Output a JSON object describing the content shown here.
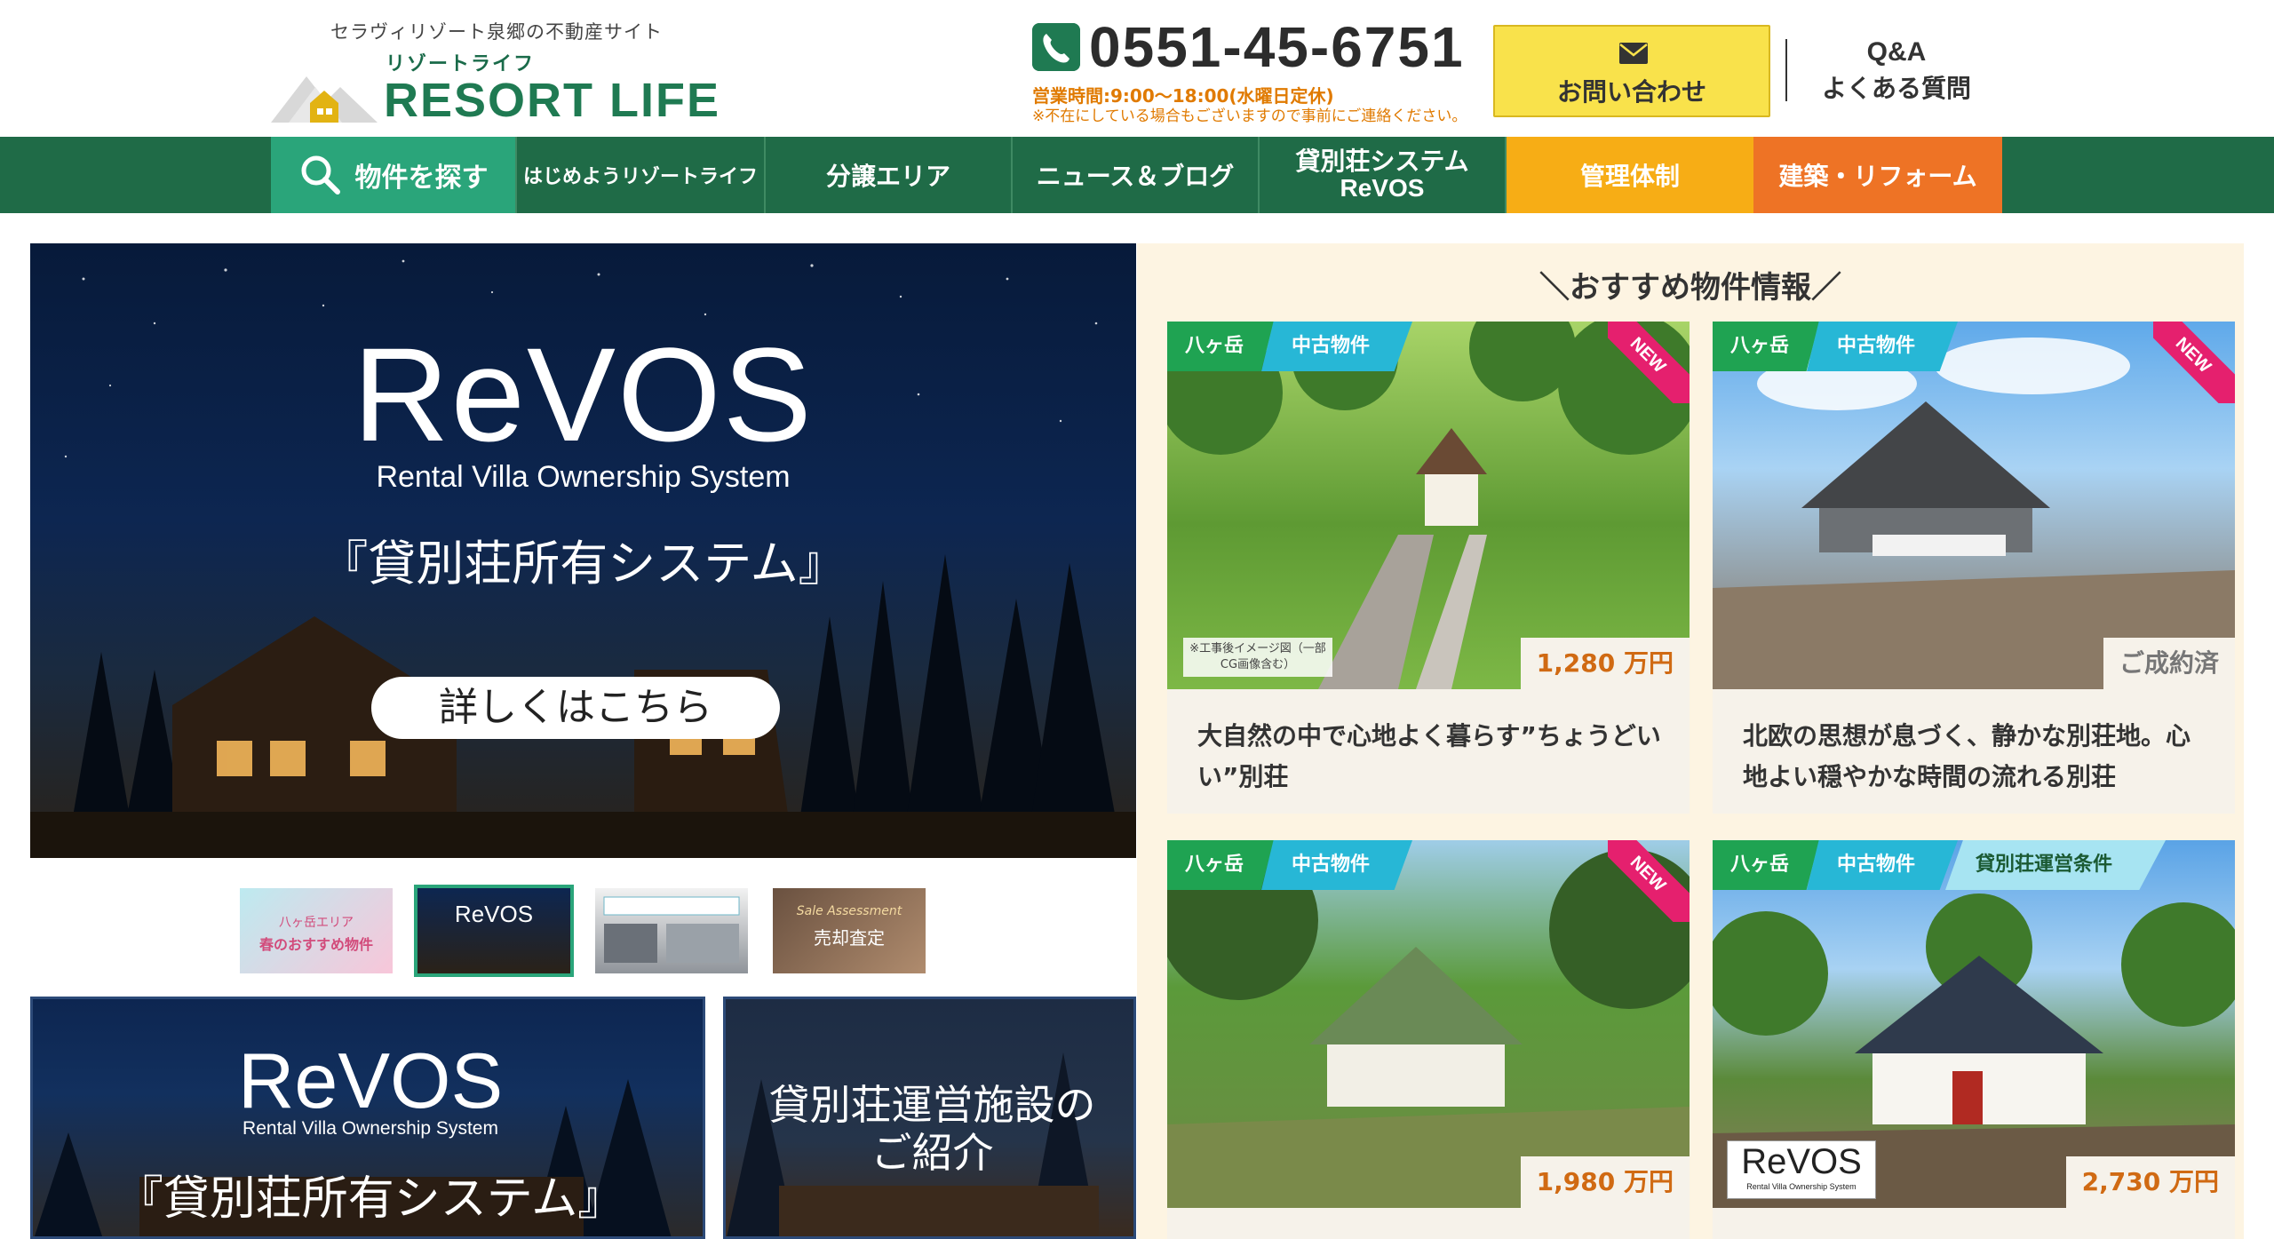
{
  "header": {
    "tagline": "セラヴィリゾート泉郷の不動産サイト",
    "logo_sub": "リゾートライフ",
    "logo_main": "RESORT LIFE",
    "phone": "0551-45-6751",
    "hours": "営業時間:9:00～18:00(水曜日定休)",
    "hours_note": "※不在にしている場合もございますので事前にご連絡ください。",
    "contact_label": "お問い合わせ",
    "faq_line1": "Q&A",
    "faq_line2": "よくある質問"
  },
  "nav": {
    "search": "物件を探す",
    "start": "はじめようリゾートライフ",
    "area": "分譲エリア",
    "news": "ニュース＆ブログ",
    "rental_line1": "貸別荘システム",
    "rental_line2": "ReVOS",
    "mgmt": "管理体制",
    "build": "建築・リフォーム"
  },
  "hero": {
    "title": "ReVOS",
    "subtitle": "Rental Villa Ownership System",
    "jp": "『貸別荘所有システム』",
    "button": "詳しくはこちら"
  },
  "thumbs": {
    "t1_line1": "八ヶ岳エリア",
    "t1_line2": "春のおすすめ物件",
    "t2": "ReVOS",
    "t4_line1": "Sale Assessment",
    "t4_line2": "売却査定"
  },
  "banners": {
    "b1_title": "ReVOS",
    "b1_sub": "Rental Villa Ownership System",
    "b1_jp": "『貸別荘所有システム』",
    "b2_line1": "貸別荘運営施設の",
    "b2_line2": "ご紹介"
  },
  "reco": {
    "title": "＼おすすめ物件情報／",
    "cards": [
      {
        "area": "八ヶ岳",
        "type": "中古物件",
        "new": "NEW",
        "price": "1,280 万円",
        "note": "※工事後イメージ図（一部CG画像含む）",
        "text": "大自然の中で心地よく暮らす”ちょうどいい”別荘"
      },
      {
        "area": "八ヶ岳",
        "type": "中古物件",
        "new": "NEW",
        "price": "ご成約済",
        "text": "北欧の思想が息づく、静かな別荘地。心地よい穏やかな時間の流れる別荘"
      },
      {
        "area": "八ヶ岳",
        "type": "中古物件",
        "new": "NEW",
        "price": "1,980 万円"
      },
      {
        "area": "八ヶ岳",
        "type": "中古物件",
        "cond": "貸別荘運営条件",
        "price": "2,730 万円",
        "badge": "ReVOS",
        "badge_sub": "Rental Villa Ownership System"
      }
    ]
  }
}
